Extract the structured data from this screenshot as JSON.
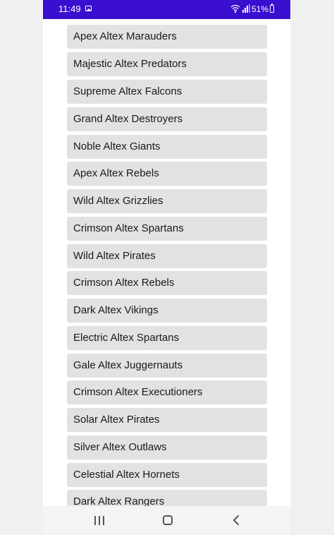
{
  "status_bar": {
    "time": "11:49",
    "battery": "51%",
    "icons": [
      "image-icon",
      "wifi-icon",
      "signal-icon",
      "battery-icon"
    ],
    "background_color": "#3a0fd0"
  },
  "list": {
    "items": [
      "Apex Altex Marauders",
      "Majestic Altex Predators",
      "Supreme Altex Falcons",
      "Grand Altex Destroyers",
      "Noble Altex Giants",
      "Apex Altex Rebels",
      "Wild Altex Grizzlies",
      "Crimson Altex Spartans",
      "Wild Altex Pirates",
      "Crimson Altex Rebels",
      "Dark Altex Vikings",
      "Electric Altex Spartans",
      "Gale Altex Juggernauts",
      "Crimson Altex Executioners",
      "Solar Altex Pirates",
      "Silver Altex Outlaws",
      "Celestial Altex Hornets",
      "Dark Altex Rangers"
    ]
  },
  "nav_bar": {
    "icons": [
      "recents-icon",
      "home-icon",
      "back-icon"
    ]
  }
}
